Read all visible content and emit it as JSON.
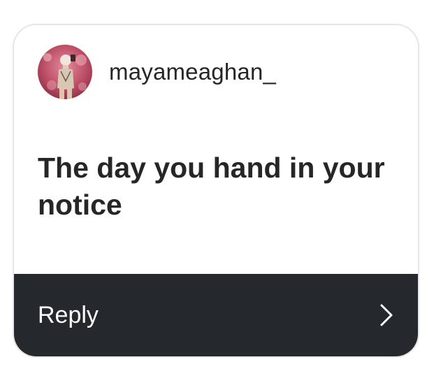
{
  "card": {
    "username": "mayameaghan_",
    "question": "The day you hand in your notice",
    "reply_label": "Reply",
    "avatar_icon": "profile-photo",
    "chevron_icon": "chevron-right-icon"
  },
  "colors": {
    "reply_bar": "#25282d",
    "text": "#262626",
    "avatar_bg": "#b84a62"
  }
}
